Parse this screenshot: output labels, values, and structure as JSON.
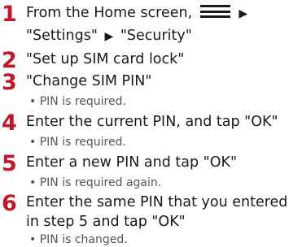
{
  "steps": [
    {
      "number": "1",
      "line1_prefix": "From the Home screen,",
      "menu_icon": "menu-icon",
      "line2": [
        "\"Settings\"",
        "\"Security\""
      ]
    },
    {
      "number": "2",
      "text": "\"Set up SIM card lock\""
    },
    {
      "number": "3",
      "text": "\"Change SIM PIN\"",
      "note": "PIN is required."
    },
    {
      "number": "4",
      "text": "Enter the current PIN, and tap \"OK\"",
      "note": "PIN is required."
    },
    {
      "number": "5",
      "text": "Enter a new PIN and tap \"OK\"",
      "note": "PIN is required again."
    },
    {
      "number": "6",
      "text": "Enter the same PIN that you entered",
      "text_line2": "in step 5 and tap \"OK\"",
      "note": "PIN is changed."
    }
  ],
  "bullet": "•",
  "arrow": "▶",
  "colors": {
    "step_number": "#c0182a",
    "text": "#1a1a1a",
    "note": "#555555"
  }
}
